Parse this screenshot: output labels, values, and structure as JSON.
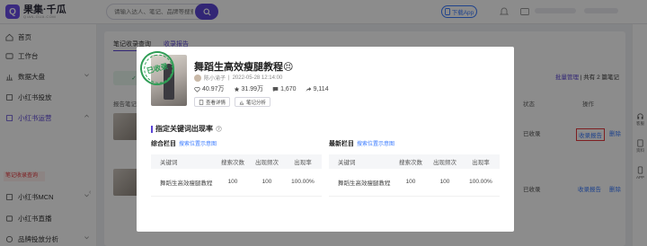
{
  "app": {
    "name": "果集·千瓜",
    "subtitle": "QIAN-GUA.COM"
  },
  "header": {
    "search_placeholder": "请输入达人、笔记、品牌等搜索",
    "download_app": "下载App"
  },
  "sidebar": {
    "items": [
      {
        "label": "首页",
        "icon": "home-icon"
      },
      {
        "label": "工作台",
        "icon": "workbench-icon"
      },
      {
        "label": "数据大盘",
        "icon": "dashboard-icon"
      },
      {
        "label": "小红书投放",
        "icon": "launch-icon"
      },
      {
        "label": "小红书运营",
        "icon": "operation-icon"
      },
      {
        "label": "小红书MCN",
        "icon": "mcn-icon"
      },
      {
        "label": "小红书直播",
        "icon": "live-icon"
      },
      {
        "label": "品牌投放分析",
        "icon": "brand-icon"
      }
    ],
    "active_subitem": "笔记收录查询"
  },
  "main": {
    "tabs": [
      "笔记收录查询",
      "收录报告"
    ],
    "columns": {
      "note": "报告笔记",
      "status": "状态",
      "action": "操作"
    },
    "batch_text": "批量管理",
    "batch_suffix": "| 共有 2 篇笔记",
    "rows": [
      {
        "status": "已收录",
        "link_report": "收录报告",
        "link_delete": "删除"
      },
      {
        "status": "已收录",
        "link_report": "收录报告",
        "link_delete": "删除"
      }
    ]
  },
  "right_rail": {
    "items": [
      {
        "label": "客服",
        "icon": "service-icon"
      },
      {
        "label": "资料",
        "icon": "document-icon"
      },
      {
        "label": "APP",
        "icon": "mobile-app-icon"
      }
    ]
  },
  "modal": {
    "stamp_text": "已收录",
    "note_title": "舞蹈生高效瘦腿教程😣",
    "author": "陈小渝子",
    "published": "2022-05-28 12:14:00",
    "stats": {
      "likes": "40.97万",
      "collects": "31.99万",
      "comments": "1,670",
      "shares": "9,114"
    },
    "buttons": {
      "view_detail": "查看详情",
      "note_analysis": "笔记分析"
    },
    "section_title": "指定关键词出现率",
    "columns": {
      "keyword": "关键词",
      "search_count": "搜索次数",
      "appear_freq": "出现频次",
      "appear_rate": "出现率"
    },
    "comprehensive": {
      "title": "综合栏目",
      "link": "搜索位置示意图",
      "row": {
        "keyword": "舞蹈生高效瘦腿教程",
        "search_count": "100",
        "appear_freq": "100",
        "appear_rate": "100.00%"
      }
    },
    "latest": {
      "title": "最新栏目",
      "link": "搜索位置示意图",
      "row": {
        "keyword": "舞蹈生高效瘦腿教程",
        "search_count": "100",
        "appear_freq": "100",
        "appear_rate": "100.00%"
      }
    }
  },
  "colors": {
    "brand_purple": "#5b45d6",
    "link_blue": "#3a7bff",
    "stamp_green": "#2f9d55",
    "active_red": "#e6393f"
  }
}
